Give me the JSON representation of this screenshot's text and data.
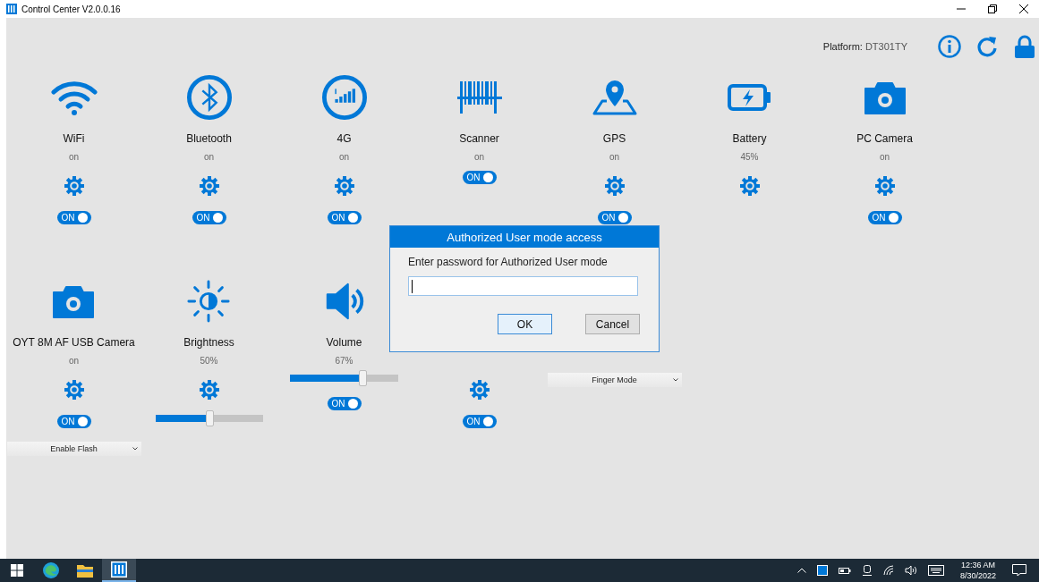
{
  "window": {
    "title": "Control Center V2.0.0.16"
  },
  "header": {
    "platform_label": "Platform:",
    "platform_value": "DT301TY"
  },
  "rows": [
    {
      "tiles": [
        {
          "kind": "wifi",
          "label": "WiFi",
          "status": "on",
          "controls": [
            {
              "kind": "gear"
            },
            {
              "kind": "toggle",
              "on": true,
              "text": "ON"
            }
          ]
        },
        {
          "kind": "bluetooth",
          "label": "Bluetooth",
          "status": "on",
          "controls": [
            {
              "kind": "gear"
            },
            {
              "kind": "toggle",
              "on": true,
              "text": "ON"
            }
          ]
        },
        {
          "kind": "cellular",
          "label": "4G",
          "status": "on",
          "controls": [
            {
              "kind": "gear"
            },
            {
              "kind": "toggle",
              "on": true,
              "text": "ON"
            }
          ]
        },
        {
          "kind": "scanner",
          "label": "Scanner",
          "status": "on",
          "controls": [
            {
              "kind": "toggle",
              "on": true,
              "text": "ON"
            }
          ]
        },
        {
          "kind": "gps",
          "label": "GPS",
          "status": "on",
          "controls": [
            {
              "kind": "gear"
            },
            {
              "kind": "toggle",
              "on": true,
              "text": "ON"
            }
          ]
        },
        {
          "kind": "battery",
          "label": "Battery",
          "status": "45%",
          "controls": [
            {
              "kind": "gear"
            }
          ]
        },
        {
          "kind": "camera",
          "label": "PC Camera",
          "status": "on",
          "controls": [
            {
              "kind": "gear"
            },
            {
              "kind": "toggle",
              "on": true,
              "text": "ON"
            }
          ]
        }
      ]
    },
    {
      "tiles": [
        {
          "kind": "camera",
          "label": "OYT 8M AF USB Camera",
          "status": "on",
          "controls": [
            {
              "kind": "gear"
            },
            {
              "kind": "toggle",
              "on": true,
              "text": "ON"
            },
            {
              "kind": "dropdown",
              "value": "Enable Flash"
            }
          ]
        },
        {
          "kind": "brightness",
          "label": "Brightness",
          "status": "50%",
          "controls": [
            {
              "kind": "gear"
            },
            {
              "kind": "slider",
              "level": 0.5
            }
          ]
        },
        {
          "kind": "volume",
          "label": "Volume",
          "status": "67%",
          "controls": [
            {
              "kind": "slider",
              "level": 0.67
            },
            {
              "kind": "toggle",
              "on": true,
              "text": "ON"
            }
          ]
        },
        {
          "kind": "covered",
          "controls": [
            {
              "kind": "gear"
            },
            {
              "kind": "toggle",
              "on": true,
              "text": "ON"
            }
          ]
        },
        {
          "kind": "covered",
          "controls": [
            {
              "kind": "dropdown",
              "value": "Finger Mode"
            }
          ]
        }
      ]
    }
  ],
  "dialog": {
    "title": "Authorized User mode access",
    "prompt": "Enter password for Authorized User mode",
    "buttons": [
      {
        "label": "OK",
        "selected": true
      },
      {
        "label": "Cancel",
        "selected": false
      }
    ]
  },
  "taskbar": {
    "apps": [
      {
        "kind": "windows",
        "selected": false
      },
      {
        "kind": "edge",
        "selected": false
      },
      {
        "kind": "folder",
        "selected": false
      },
      {
        "kind": "control-center",
        "selected": true
      }
    ],
    "clock": {
      "time": "12:36 AM",
      "date": "8/30/2022"
    }
  }
}
